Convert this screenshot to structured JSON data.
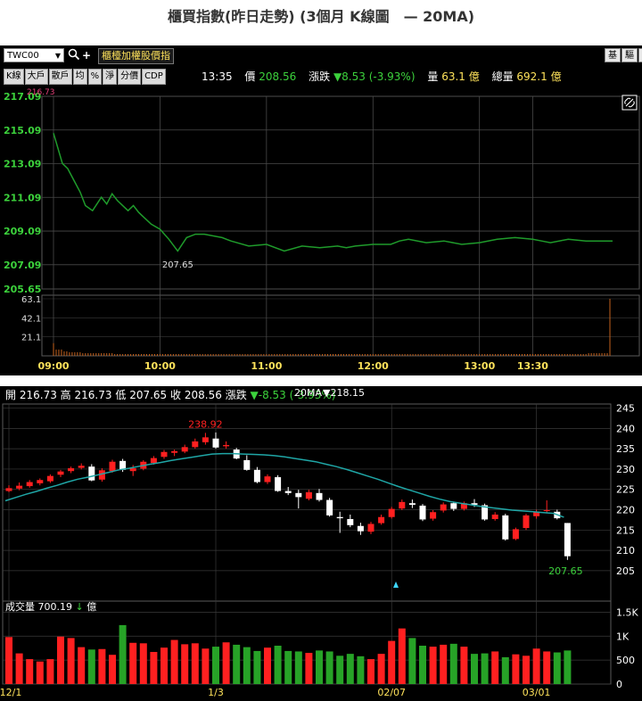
{
  "title": "櫃買指數(昨日走勢) (3個月 K線圖　— 20MA)",
  "toolbar": {
    "symbol": "TWC00",
    "symbol_name": "櫃檯加權股價指",
    "right_buttons": [
      "基",
      "驅",
      "肩"
    ]
  },
  "tabs": [
    "K線",
    "大戶",
    "散戶",
    "均",
    "%",
    "淨",
    "分價",
    "CDP"
  ],
  "quote": {
    "time": "13:35",
    "price_label": "價",
    "price": "208.56",
    "change_label": "漲跌",
    "change": "▼8.53 (-3.93%)",
    "volume_label": "量",
    "volume": "63.1 億",
    "total_label": "總量",
    "total": "692.1 億"
  },
  "intraday": {
    "open_value": "216.73",
    "low_value": "207.65",
    "price_ticks": [
      "217.09",
      "215.09",
      "213.09",
      "211.09",
      "209.09",
      "207.09",
      "205.65"
    ],
    "volume_ticks": [
      "63.1",
      "42.1",
      "21.1"
    ],
    "time_ticks": [
      "09:00",
      "10:00",
      "11:00",
      "12:00",
      "13:00",
      "13:30"
    ],
    "colors": {
      "price_line": "#1f9b2b",
      "volume": "#c8641e",
      "grid": "#5a5a5a"
    }
  },
  "kline": {
    "ohlc": {
      "open_label": "開",
      "open": "216.73",
      "high_label": "高",
      "high": "216.73",
      "low_label": "低",
      "low": "207.65",
      "close_label": "收",
      "close": "208.56",
      "change_label": "漲跌",
      "change": "▼-8.53 (-3.93%)"
    },
    "ma_label": "20MA",
    "ma_value": "▼218.15",
    "peak_value": "238.92",
    "last_value": "207.65",
    "price_ticks": [
      "245",
      "240",
      "235",
      "230",
      "225",
      "220",
      "215",
      "210",
      "205"
    ],
    "volume_ticks": [
      "1.5K",
      "1K",
      "500",
      "0"
    ],
    "date_ticks": [
      "12/1",
      "1/3",
      "02/07",
      "03/01"
    ],
    "volume_label": "成交量",
    "volume_value": "700.19",
    "volume_arrow": "↓",
    "volume_unit": "億",
    "colors": {
      "up": "#ff2020",
      "down": "#ffffff",
      "ma": "#1fa6a6",
      "vol_up": "#ff2020",
      "vol_down": "#27a327"
    }
  },
  "chart_data": [
    {
      "type": "line",
      "title": "",
      "x_unit": "minutes since 09:00",
      "x": [
        0,
        5,
        8,
        12,
        15,
        18,
        22,
        27,
        30,
        33,
        36,
        40,
        42,
        45,
        48,
        50,
        55,
        60,
        65,
        70,
        75,
        80,
        85,
        90,
        95,
        100,
        110,
        120,
        130,
        140,
        150,
        160,
        165,
        170,
        180,
        190,
        195,
        200,
        210,
        220,
        230,
        240,
        250,
        260,
        270,
        275,
        280,
        290,
        300,
        310,
        315
      ],
      "y": [
        214.9,
        213.1,
        212.8,
        212.0,
        211.4,
        210.6,
        210.3,
        211.1,
        210.7,
        211.3,
        210.9,
        210.5,
        210.3,
        210.6,
        210.2,
        210.0,
        209.5,
        209.2,
        208.6,
        207.9,
        208.7,
        208.9,
        208.9,
        208.8,
        208.7,
        208.5,
        208.2,
        208.3,
        207.9,
        208.2,
        208.1,
        208.2,
        208.1,
        208.2,
        208.3,
        208.3,
        208.5,
        208.6,
        208.4,
        208.5,
        208.3,
        208.4,
        208.6,
        208.7,
        208.6,
        208.5,
        208.4,
        208.6,
        208.5,
        208.5,
        208.5
      ],
      "ylim": [
        205.65,
        217.09
      ],
      "volume": [
        14,
        7,
        5,
        4,
        4,
        3,
        3,
        3,
        3,
        3,
        2,
        2,
        2,
        2,
        2,
        2,
        2,
        2,
        2,
        2,
        2,
        2,
        2,
        2,
        2,
        2,
        2,
        2,
        2,
        2,
        2,
        2,
        2,
        2,
        2,
        2,
        2,
        2,
        2,
        2,
        2,
        2,
        2,
        2,
        2,
        2,
        2,
        2,
        2,
        3,
        63.1
      ],
      "annotations": [
        {
          "x": 70,
          "y": 207.65,
          "text": "207.65"
        }
      ]
    },
    {
      "type": "candlestick",
      "title": "",
      "ylim": [
        203,
        246
      ],
      "candles": [
        [
          224.6,
          226.0,
          224.3,
          225.3
        ],
        [
          225.2,
          226.7,
          224.8,
          225.9
        ],
        [
          225.8,
          227.3,
          225.4,
          226.8
        ],
        [
          226.5,
          227.7,
          226.0,
          227.3
        ],
        [
          227.0,
          228.7,
          226.6,
          228.3
        ],
        [
          228.6,
          229.8,
          228.0,
          229.4
        ],
        [
          229.5,
          230.6,
          229.0,
          230.2
        ],
        [
          230.3,
          231.4,
          229.9,
          230.8
        ],
        [
          230.6,
          231.2,
          227.0,
          227.2
        ],
        [
          227.4,
          230.2,
          226.9,
          229.7
        ],
        [
          229.5,
          232.3,
          229.1,
          231.8
        ],
        [
          232.0,
          232.5,
          229.3,
          229.8
        ],
        [
          229.5,
          231.0,
          228.3,
          230.2
        ],
        [
          230.1,
          232.2,
          229.7,
          231.8
        ],
        [
          231.5,
          233.2,
          231.1,
          232.7
        ],
        [
          233.0,
          234.7,
          232.5,
          234.2
        ],
        [
          234.0,
          234.8,
          233.2,
          234.4
        ],
        [
          234.3,
          236.0,
          233.9,
          235.4
        ],
        [
          235.4,
          237.5,
          235.0,
          236.8
        ],
        [
          236.6,
          238.9,
          236.0,
          237.8
        ],
        [
          237.5,
          239.0,
          235.0,
          235.3
        ],
        [
          235.6,
          236.8,
          235.0,
          235.9
        ],
        [
          234.8,
          235.2,
          232.4,
          232.6
        ],
        [
          232.2,
          233.4,
          229.6,
          229.8
        ],
        [
          229.8,
          230.5,
          226.5,
          226.8
        ],
        [
          226.8,
          228.7,
          226.3,
          228.2
        ],
        [
          228.0,
          228.5,
          224.4,
          224.6
        ],
        [
          224.6,
          225.6,
          223.6,
          224.1
        ],
        [
          224.1,
          224.9,
          220.3,
          223.1
        ],
        [
          222.7,
          224.9,
          222.3,
          224.3
        ],
        [
          224.1,
          225.1,
          222.0,
          222.4
        ],
        [
          222.4,
          222.9,
          218.3,
          218.6
        ],
        [
          218.2,
          219.5,
          214.3,
          217.9
        ],
        [
          217.7,
          218.8,
          215.7,
          216.2
        ],
        [
          216.0,
          216.8,
          213.8,
          214.7
        ],
        [
          214.6,
          217.0,
          214.0,
          216.5
        ],
        [
          216.7,
          218.8,
          216.3,
          218.2
        ],
        [
          218.2,
          220.7,
          217.8,
          220.2
        ],
        [
          220.3,
          222.5,
          219.9,
          221.9
        ],
        [
          221.6,
          222.5,
          220.4,
          221.2
        ],
        [
          221.0,
          221.4,
          217.2,
          217.6
        ],
        [
          217.8,
          219.9,
          217.3,
          219.4
        ],
        [
          219.8,
          221.8,
          219.3,
          221.3
        ],
        [
          221.6,
          222.0,
          219.7,
          220.2
        ],
        [
          220.2,
          222.0,
          219.8,
          221.6
        ],
        [
          221.6,
          222.6,
          220.7,
          221.2
        ],
        [
          221.1,
          221.5,
          217.3,
          217.6
        ],
        [
          217.7,
          219.4,
          217.3,
          218.8
        ],
        [
          218.6,
          219.0,
          212.4,
          212.7
        ],
        [
          212.8,
          215.6,
          212.5,
          215.2
        ],
        [
          215.5,
          219.0,
          215.0,
          218.6
        ],
        [
          218.4,
          220.0,
          217.8,
          219.5
        ],
        [
          219.7,
          222.3,
          219.2,
          219.9
        ],
        [
          219.5,
          220.0,
          217.6,
          217.9
        ],
        [
          216.73,
          216.73,
          207.65,
          208.56
        ]
      ],
      "ma20": [
        222.2,
        223.0,
        223.8,
        224.5,
        225.3,
        226.0,
        226.8,
        227.5,
        228.0,
        228.6,
        229.2,
        229.8,
        230.2,
        230.7,
        231.2,
        231.6,
        232.1,
        232.5,
        232.9,
        233.3,
        233.7,
        233.8,
        233.8,
        233.7,
        233.6,
        233.5,
        233.3,
        233.0,
        232.6,
        232.2,
        231.8,
        231.2,
        230.6,
        229.9,
        229.1,
        228.3,
        227.5,
        226.6,
        225.7,
        224.9,
        224.1,
        223.3,
        222.6,
        222.0,
        221.6,
        221.2,
        220.8,
        220.5,
        220.2,
        219.9,
        219.7,
        219.5,
        219.3,
        219.1,
        218.15
      ],
      "volume": [
        980,
        640,
        520,
        470,
        520,
        990,
        960,
        770,
        720,
        730,
        610,
        1230,
        860,
        850,
        670,
        760,
        920,
        830,
        850,
        740,
        780,
        870,
        820,
        770,
        690,
        760,
        800,
        690,
        680,
        650,
        700,
        680,
        590,
        630,
        580,
        520,
        630,
        900,
        1160,
        960,
        800,
        780,
        820,
        840,
        780,
        630,
        640,
        680,
        560,
        620,
        590,
        740,
        680,
        660,
        700.19
      ]
    }
  ]
}
